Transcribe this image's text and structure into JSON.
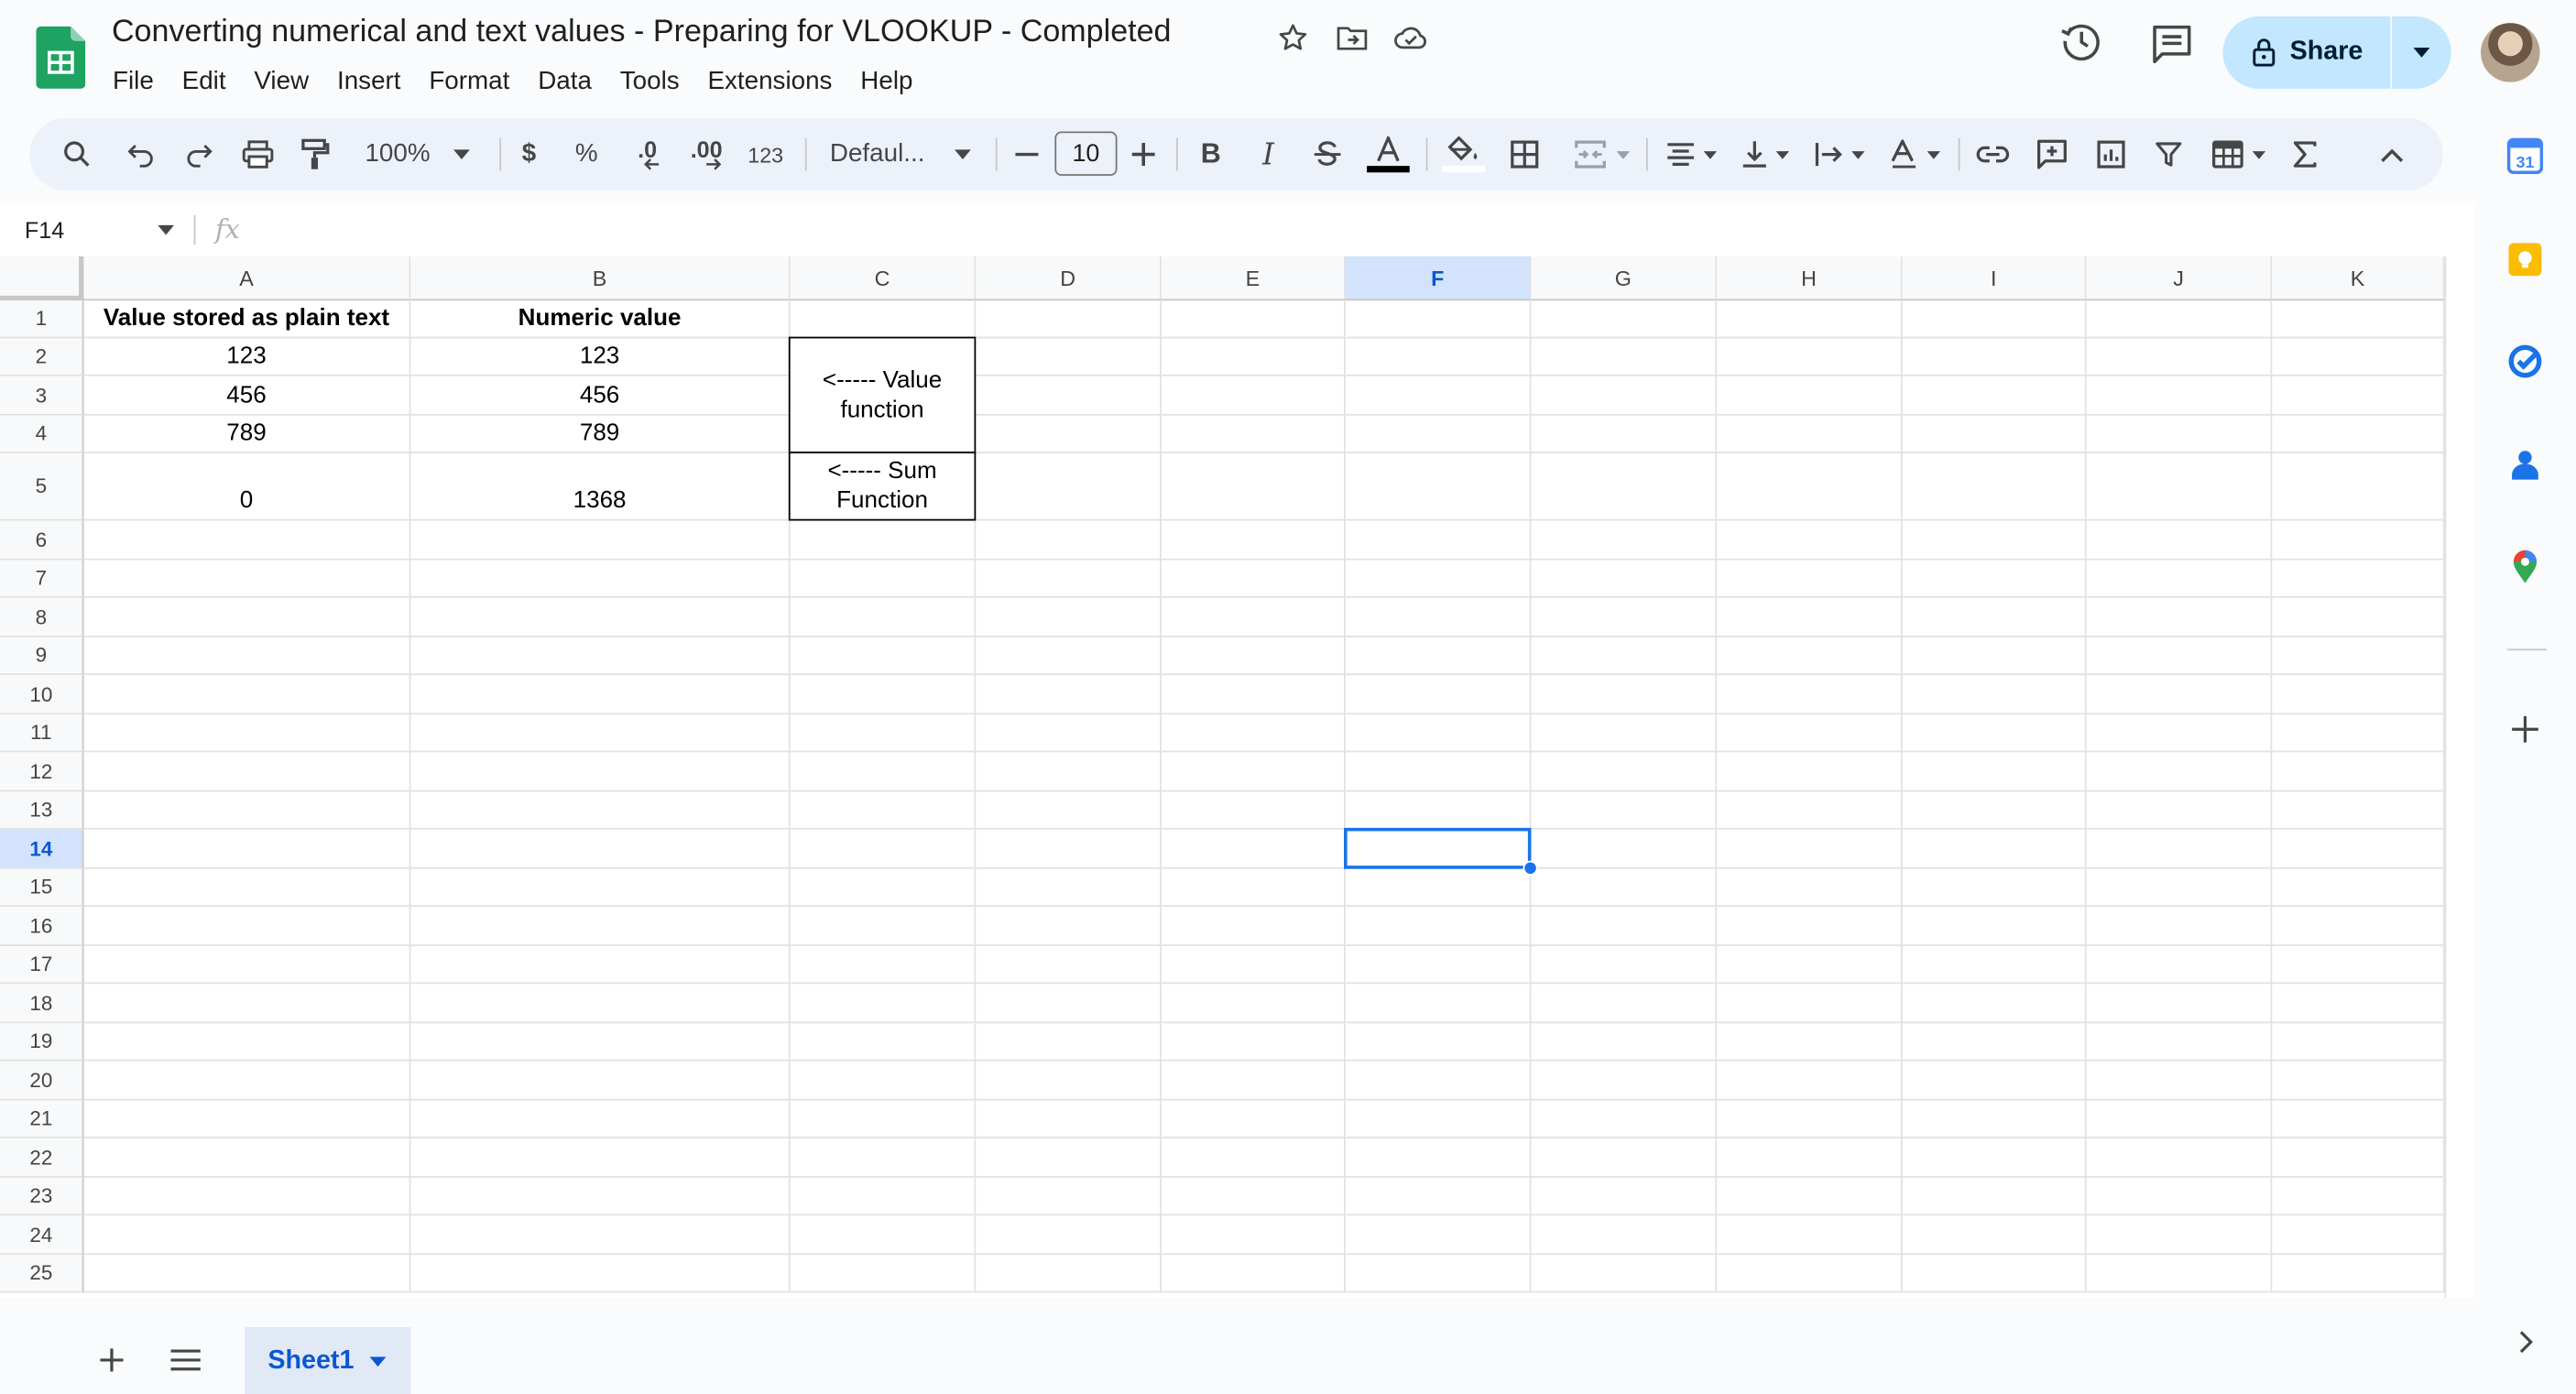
{
  "document": {
    "title": "Converting numerical and text values - Preparing for VLOOKUP - Completed"
  },
  "menu": [
    "File",
    "Edit",
    "View",
    "Insert",
    "Format",
    "Data",
    "Tools",
    "Extensions",
    "Help"
  ],
  "header": {
    "share_label": "Share"
  },
  "toolbar": {
    "zoom": "100%",
    "currency": "$",
    "percent": "%",
    "decrease_decimal": ".0",
    "increase_decimal": ".00",
    "number_format": "123",
    "font": "Defaul...",
    "font_size": "10"
  },
  "formula_bar": {
    "cell_ref": "F14",
    "fx": "fx",
    "formula": ""
  },
  "columns": [
    "A",
    "B",
    "C",
    "D",
    "E",
    "F",
    "G",
    "H",
    "I",
    "J",
    "K"
  ],
  "rows": [
    "1",
    "2",
    "3",
    "4",
    "5",
    "6",
    "7",
    "8",
    "9",
    "10",
    "11",
    "12",
    "13",
    "14",
    "15",
    "16",
    "17",
    "18",
    "19",
    "20",
    "21",
    "22",
    "23",
    "24",
    "25"
  ],
  "selected": {
    "column": "F",
    "row": "14"
  },
  "cells": {
    "A1": "Value stored as plain text",
    "B1": "Numeric value",
    "A2": "123",
    "B2": "123",
    "A3": "456",
    "B3": "456",
    "A4": "789",
    "B4": "789",
    "A5": "0",
    "B5": "1368",
    "C2": "<----- Value function",
    "C5": "<----- Sum Function"
  },
  "sheets": [
    {
      "name": "Sheet1",
      "active": true
    }
  ],
  "side_panel_icons": [
    "calendar-icon",
    "keep-icon",
    "tasks-icon",
    "contacts-icon",
    "maps-icon",
    "add-icon"
  ]
}
